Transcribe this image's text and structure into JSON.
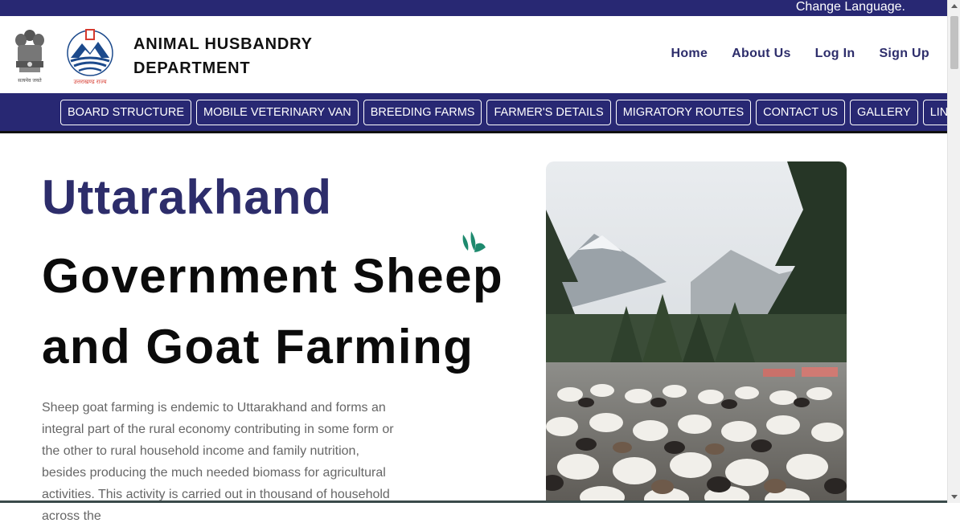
{
  "lang_bar": {
    "link_label": "Change Language."
  },
  "header": {
    "dept_name": "ANIMAL HUSBANDRY\nDEPARTMENT",
    "emblem_caption": "सत्यमेव जयते",
    "logo_caption": "उत्तराखण्ड राज्य",
    "nav": [
      {
        "label": "Home"
      },
      {
        "label": "About Us"
      },
      {
        "label": "Log In"
      },
      {
        "label": "Sign Up"
      }
    ]
  },
  "menu": [
    {
      "label": "BOARD STRUCTURE"
    },
    {
      "label": "MOBILE VETERINARY VAN"
    },
    {
      "label": "BREEDING FARMS"
    },
    {
      "label": "FARMER'S DETAILS"
    },
    {
      "label": "MIGRATORY ROUTES"
    },
    {
      "label": "CONTACT US"
    },
    {
      "label": "GALLERY"
    },
    {
      "label": "LINKS"
    }
  ],
  "hero": {
    "title_line1": "Uttarakhand",
    "title_line2": "Government Sheep and Goat Farming",
    "description": "Sheep goat farming is endemic to Uttarakhand and forms an integral part of the rural economy contributing in some form or the other to rural household income and family nutrition, besides producing the much needed biomass for agricultural activities. This activity is carried out in thousand of household across the"
  },
  "colors": {
    "navy": "#282873",
    "title_blue": "#2d2d6b",
    "leaf_green": "#1e8a6e"
  }
}
